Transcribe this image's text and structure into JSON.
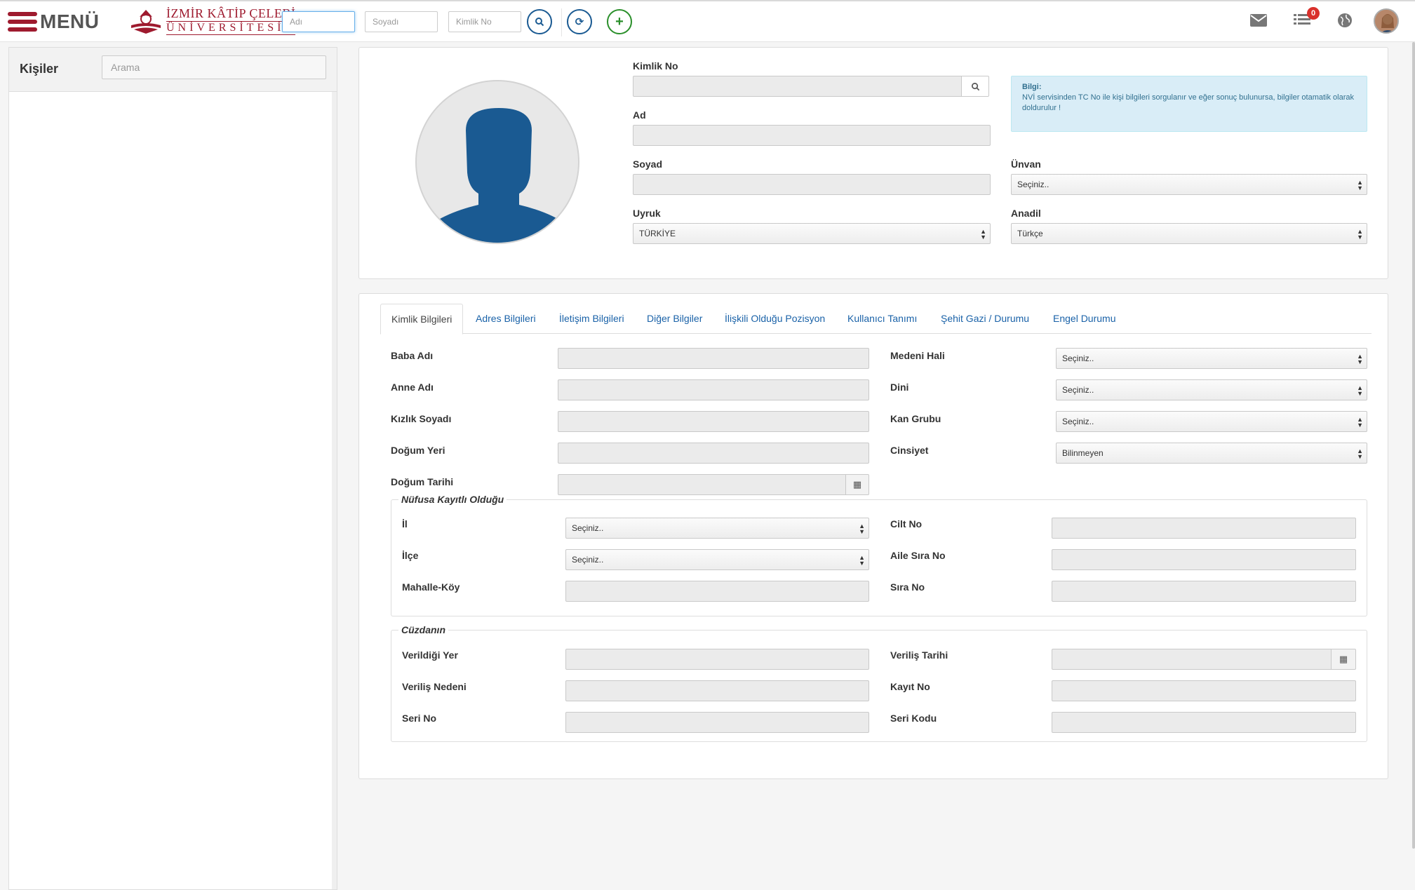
{
  "header": {
    "menu_label": "MENÜ",
    "logo_line1": "İZMİR KÂTİP ÇELEBİ",
    "logo_line2": "ÜNİVERSİTESİ",
    "search_name_placeholder": "Adı",
    "search_surname_placeholder": "Soyadı",
    "search_id_placeholder": "Kimlik No",
    "notification_count": "0"
  },
  "sidebar": {
    "title": "Kişiler",
    "search_placeholder": "Arama"
  },
  "profile": {
    "labels": {
      "kimlik_no": "Kimlik No",
      "ad": "Ad",
      "soyad": "Soyad",
      "unvan": "Ünvan",
      "uyruk": "Uyruk",
      "anadil": "Anadil"
    },
    "values": {
      "unvan": "Seçiniz..",
      "uyruk": "TÜRKİYE",
      "anadil": "Türkçe"
    },
    "info_title": "Bilgi:",
    "info_text": "NVİ servisinden TC No ile kişi bilgileri sorgulanır ve eğer sonuç bulunursa, bilgiler otamatik olarak doldurulur !"
  },
  "tabs": [
    {
      "label": "Kimlik Bilgileri"
    },
    {
      "label": "Adres Bilgileri"
    },
    {
      "label": "İletişim Bilgileri"
    },
    {
      "label": "Diğer Bilgiler"
    },
    {
      "label": "İlişkili Olduğu Pozisyon"
    },
    {
      "label": "Kullanıcı Tanımı"
    },
    {
      "label": "Şehit Gazi / Durumu"
    },
    {
      "label": "Engel Durumu"
    }
  ],
  "identity": {
    "left_labels": [
      "Baba Adı",
      "Anne Adı",
      "Kızlık Soyadı",
      "Doğum Yeri",
      "Doğum Tarihi"
    ],
    "right_labels": [
      "Medeni Hali",
      "Dini",
      "Kan Grubu",
      "Cinsiyet"
    ],
    "right_values": [
      "Seçiniz..",
      "Seçiniz..",
      "Seçiniz..",
      "Bilinmeyen"
    ]
  },
  "registry": {
    "legend": "Nüfusa Kayıtlı Olduğu",
    "left_labels": [
      "İl",
      "İlçe",
      "Mahalle-Köy"
    ],
    "left_values": [
      "Seçiniz..",
      "Seçiniz.."
    ],
    "right_labels": [
      "Cilt No",
      "Aile Sıra No",
      "Sıra No"
    ]
  },
  "wallet": {
    "legend": "Cüzdanın",
    "left_labels": [
      "Verildiği Yer",
      "Veriliş Nedeni",
      "Seri No"
    ],
    "right_labels": [
      "Veriliş Tarihi",
      "Kayıt No",
      "Seri Kodu"
    ]
  }
}
